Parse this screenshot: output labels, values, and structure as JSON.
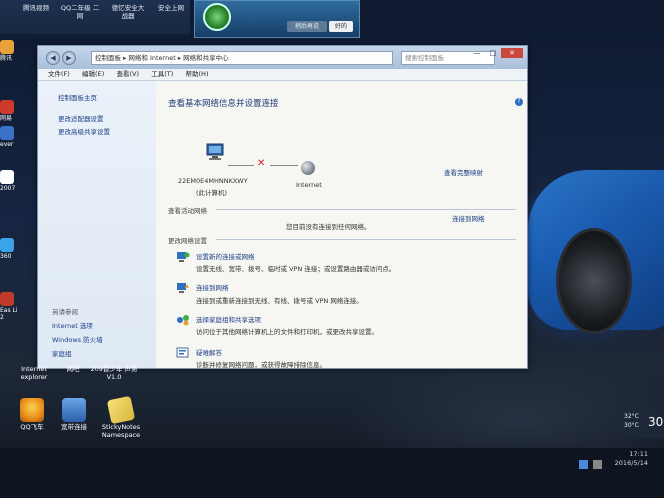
{
  "top_labels": [
    "腾讯视频",
    "QQ二年级 二网",
    "德忆安全大 战器",
    "安全上网"
  ],
  "qq_popup": {
    "later_button": "稍后再说",
    "ok_button": "好的"
  },
  "left_icons": [
    {
      "label": "腾讯"
    },
    {
      "label": "网易"
    },
    {
      "label": "ever"
    },
    {
      "label": "2007"
    },
    {
      "label": "360"
    },
    {
      "label": "Eas Li 2"
    }
  ],
  "window": {
    "address": "控制面板 ▸ 网络和 Internet ▸ 网络和共享中心",
    "search_placeholder": "搜索控制面板",
    "controls": {
      "minimize": "—",
      "maximize": "□",
      "close": "✕"
    },
    "menu": [
      "文件(F)",
      "编辑(E)",
      "查看(V)",
      "工具(T)",
      "帮助(H)"
    ],
    "left_pane": {
      "home": "控制面板主页",
      "links": [
        "更改适配器设置",
        "更改高级共享设置"
      ],
      "see_also": "另请参阅",
      "see_also_links": [
        "Internet 选项",
        "Windows 防火墙",
        "家庭组"
      ]
    },
    "main": {
      "title": "查看基本网络信息并设置连接",
      "see_full_map": "查看完整映射",
      "computer_name": "22EM0E4MHNNKXWY",
      "computer_sub": "(此计算机)",
      "internet_label": "Internet",
      "active_networks_heading": "查看活动网络",
      "connect_link": "连接到网络",
      "not_connected": "您目前没有连接到任何网络。",
      "change_settings_heading": "更改网络设置",
      "tasks": [
        {
          "icon": "network-setup-icon",
          "link": "设置新的连接或网络",
          "desc": "设置无线、宽带、拨号、临时或 VPN 连接；或设置路由器或访问点。"
        },
        {
          "icon": "connect-network-icon",
          "link": "连接到网络",
          "desc": "连接到或重新连接到无线、有线、拨号或 VPN 网络连接。"
        },
        {
          "icon": "homegroup-sharing-icon",
          "link": "选择家庭组和共享选项",
          "desc": "访问位于其他网络计算机上的文件和打印机，或更改共享设置。"
        },
        {
          "icon": "troubleshoot-icon",
          "link": "疑难解答",
          "desc": "诊断并修复网络问题，或获得故障排除信息。"
        }
      ]
    }
  },
  "desktop_icons": [
    {
      "label": "QQ飞车",
      "icon": "qq-speed-icon"
    },
    {
      "label": "宽带连接",
      "icon": "broadband-connection-icon"
    },
    {
      "label": "StickyNotes Namespace",
      "icon": "sticky-notes-icon"
    }
  ],
  "desktop_icons_row2": [
    {
      "label": "Internet explorer"
    },
    {
      "label": "网吧"
    },
    {
      "label": "209首少年 声第 V1.0"
    }
  ],
  "widget": {
    "temp": "30",
    "line1": "32°C",
    "line2": "30°C"
  },
  "tray": {
    "time": "17:11",
    "date": "2016/5/14"
  }
}
